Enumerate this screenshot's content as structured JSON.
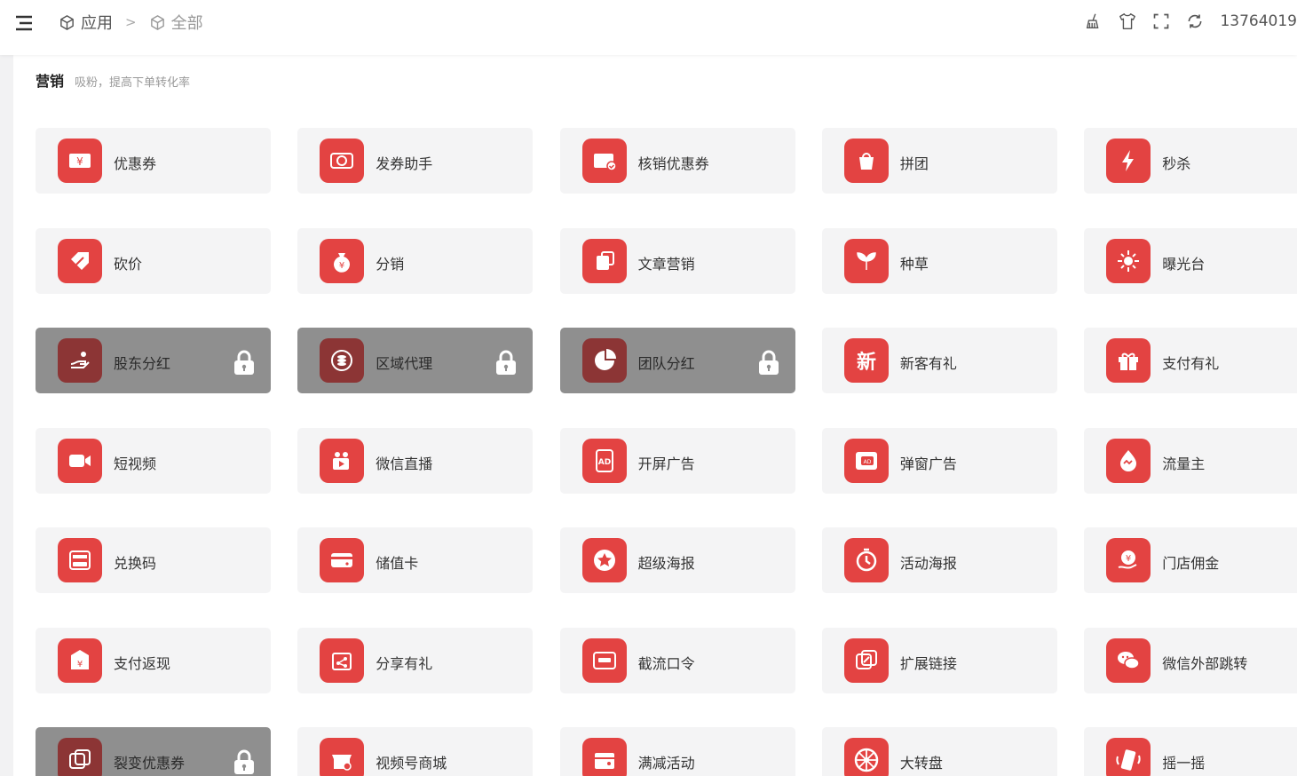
{
  "header": {
    "breadcrumb": [
      {
        "label": "应用",
        "icon": "cube-icon"
      },
      {
        "label": "全部",
        "icon": "cube-icon"
      }
    ],
    "separator": ">",
    "tools": [
      "broom-icon",
      "tshirt-icon",
      "fullscreen-icon",
      "refresh-icon"
    ],
    "user": "13764019"
  },
  "section": {
    "title": "营销",
    "desc": "吸粉，提高下单转化率"
  },
  "cards": [
    {
      "label": "优惠券",
      "icon": "coupon-icon",
      "locked": false
    },
    {
      "label": "发券助手",
      "icon": "coupon-helper-icon",
      "locked": false
    },
    {
      "label": "核销优惠券",
      "icon": "coupon-verify-icon",
      "locked": false
    },
    {
      "label": "拼团",
      "icon": "group-buy-icon",
      "locked": false
    },
    {
      "label": "秒杀",
      "icon": "lightning-icon",
      "locked": false
    },
    {
      "label": "砍价",
      "icon": "bargain-icon",
      "locked": false
    },
    {
      "label": "分销",
      "icon": "money-bag-icon",
      "locked": false
    },
    {
      "label": "文章营销",
      "icon": "article-icon",
      "locked": false
    },
    {
      "label": "种草",
      "icon": "sprout-icon",
      "locked": false
    },
    {
      "label": "曝光台",
      "icon": "sun-icon",
      "locked": false
    },
    {
      "label": "股东分红",
      "icon": "dividend-icon",
      "locked": true
    },
    {
      "label": "区域代理",
      "icon": "coin-stack-icon",
      "locked": true
    },
    {
      "label": "团队分红",
      "icon": "pie-chart-icon",
      "locked": true
    },
    {
      "label": "新客有礼",
      "icon": "new-customer-icon",
      "locked": false
    },
    {
      "label": "支付有礼",
      "icon": "gift-icon",
      "locked": false
    },
    {
      "label": "短视频",
      "icon": "video-camera-icon",
      "locked": false
    },
    {
      "label": "微信直播",
      "icon": "live-stream-icon",
      "locked": false
    },
    {
      "label": "开屏广告",
      "icon": "ad-icon",
      "locked": false
    },
    {
      "label": "弹窗广告",
      "icon": "popup-ad-icon",
      "locked": false
    },
    {
      "label": "流量主",
      "icon": "traffic-drop-icon",
      "locked": false
    },
    {
      "label": "兑换码",
      "icon": "redeem-code-icon",
      "locked": false
    },
    {
      "label": "储值卡",
      "icon": "stored-card-icon",
      "locked": false
    },
    {
      "label": "超级海报",
      "icon": "star-poster-icon",
      "locked": false
    },
    {
      "label": "活动海报",
      "icon": "timer-icon",
      "locked": false
    },
    {
      "label": "门店佣金",
      "icon": "store-commission-icon",
      "locked": false
    },
    {
      "label": "支付返现",
      "icon": "cashback-icon",
      "locked": false
    },
    {
      "label": "分享有礼",
      "icon": "share-gift-icon",
      "locked": false
    },
    {
      "label": "截流口令",
      "icon": "command-icon",
      "locked": false
    },
    {
      "label": "扩展链接",
      "icon": "link-icon",
      "locked": false
    },
    {
      "label": "微信外部跳转",
      "icon": "wechat-icon",
      "locked": false
    },
    {
      "label": "裂变优惠券",
      "icon": "fission-coupon-icon",
      "locked": true
    },
    {
      "label": "视频号商城",
      "icon": "video-shop-icon",
      "locked": false
    },
    {
      "label": "满减活动",
      "icon": "discount-icon",
      "locked": false
    },
    {
      "label": "大转盘",
      "icon": "wheel-icon",
      "locked": false
    },
    {
      "label": "摇一摇",
      "icon": "shake-icon",
      "locked": false
    }
  ],
  "colors": {
    "accent": "#e34342",
    "locked_bg": "#8f8f8f",
    "card_bg": "#f4f4f5"
  }
}
